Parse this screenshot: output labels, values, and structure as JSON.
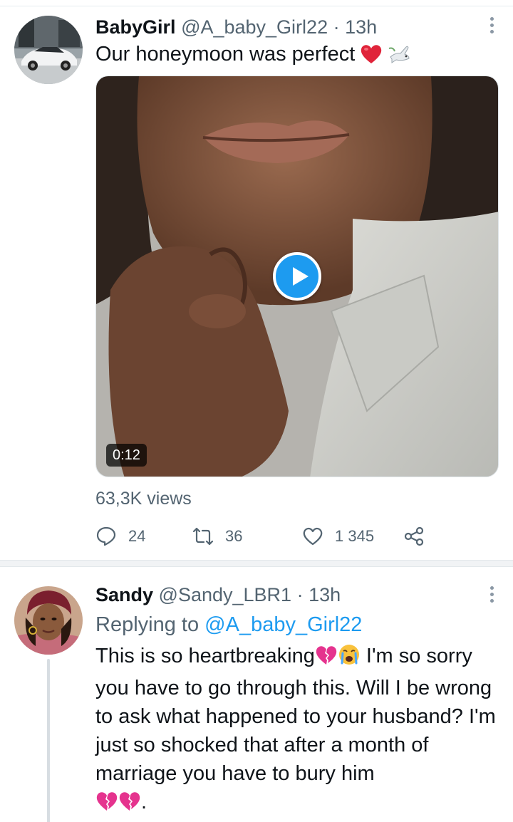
{
  "tweet": {
    "name": "BabyGirl",
    "handle": "@A_baby_Girl22",
    "separator": "·",
    "time": "13h",
    "text": "Our honeymoon was perfect",
    "emoji": [
      "red-heart",
      "dove"
    ],
    "media": {
      "type": "video",
      "duration": "0:12",
      "play_icon": "play-icon"
    },
    "views": "63,3K views",
    "actions": {
      "replies": "24",
      "retweets": "36",
      "likes": "1 345"
    }
  },
  "reply": {
    "name": "Sandy",
    "handle": "@Sandy_LBR1",
    "separator": "·",
    "time": "13h",
    "replying_prefix": "Replying to",
    "replying_to": "@A_baby_Girl22",
    "text_part1": "This is so heartbreaking",
    "text_part2": " I'm so sorry you have to go through this.  Will I be wrong to ask what happened to your husband? I'm just so shocked that after a month of marriage you have to bury him",
    "text_end": ".",
    "emoji": [
      "broken-heart",
      "crying-face",
      "broken-heart",
      "broken-heart"
    ]
  },
  "colors": {
    "accent": "#1d9bf0",
    "text_primary": "#0f1419",
    "text_secondary": "#536471",
    "heart_red": "#e0243a",
    "broken_heart_pink": "#e5338e"
  }
}
